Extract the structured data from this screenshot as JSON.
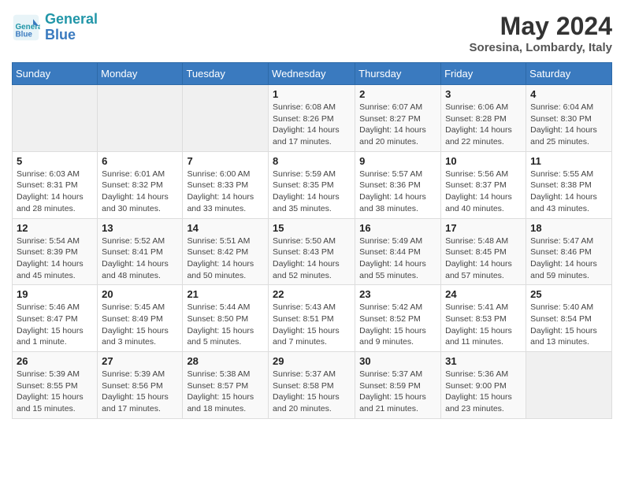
{
  "header": {
    "logo_line1": "General",
    "logo_line2": "Blue",
    "month_year": "May 2024",
    "location": "Soresina, Lombardy, Italy"
  },
  "days_of_week": [
    "Sunday",
    "Monday",
    "Tuesday",
    "Wednesday",
    "Thursday",
    "Friday",
    "Saturday"
  ],
  "weeks": [
    [
      {
        "day": "",
        "info": ""
      },
      {
        "day": "",
        "info": ""
      },
      {
        "day": "",
        "info": ""
      },
      {
        "day": "1",
        "info": "Sunrise: 6:08 AM\nSunset: 8:26 PM\nDaylight: 14 hours\nand 17 minutes."
      },
      {
        "day": "2",
        "info": "Sunrise: 6:07 AM\nSunset: 8:27 PM\nDaylight: 14 hours\nand 20 minutes."
      },
      {
        "day": "3",
        "info": "Sunrise: 6:06 AM\nSunset: 8:28 PM\nDaylight: 14 hours\nand 22 minutes."
      },
      {
        "day": "4",
        "info": "Sunrise: 6:04 AM\nSunset: 8:30 PM\nDaylight: 14 hours\nand 25 minutes."
      }
    ],
    [
      {
        "day": "5",
        "info": "Sunrise: 6:03 AM\nSunset: 8:31 PM\nDaylight: 14 hours\nand 28 minutes."
      },
      {
        "day": "6",
        "info": "Sunrise: 6:01 AM\nSunset: 8:32 PM\nDaylight: 14 hours\nand 30 minutes."
      },
      {
        "day": "7",
        "info": "Sunrise: 6:00 AM\nSunset: 8:33 PM\nDaylight: 14 hours\nand 33 minutes."
      },
      {
        "day": "8",
        "info": "Sunrise: 5:59 AM\nSunset: 8:35 PM\nDaylight: 14 hours\nand 35 minutes."
      },
      {
        "day": "9",
        "info": "Sunrise: 5:57 AM\nSunset: 8:36 PM\nDaylight: 14 hours\nand 38 minutes."
      },
      {
        "day": "10",
        "info": "Sunrise: 5:56 AM\nSunset: 8:37 PM\nDaylight: 14 hours\nand 40 minutes."
      },
      {
        "day": "11",
        "info": "Sunrise: 5:55 AM\nSunset: 8:38 PM\nDaylight: 14 hours\nand 43 minutes."
      }
    ],
    [
      {
        "day": "12",
        "info": "Sunrise: 5:54 AM\nSunset: 8:39 PM\nDaylight: 14 hours\nand 45 minutes."
      },
      {
        "day": "13",
        "info": "Sunrise: 5:52 AM\nSunset: 8:41 PM\nDaylight: 14 hours\nand 48 minutes."
      },
      {
        "day": "14",
        "info": "Sunrise: 5:51 AM\nSunset: 8:42 PM\nDaylight: 14 hours\nand 50 minutes."
      },
      {
        "day": "15",
        "info": "Sunrise: 5:50 AM\nSunset: 8:43 PM\nDaylight: 14 hours\nand 52 minutes."
      },
      {
        "day": "16",
        "info": "Sunrise: 5:49 AM\nSunset: 8:44 PM\nDaylight: 14 hours\nand 55 minutes."
      },
      {
        "day": "17",
        "info": "Sunrise: 5:48 AM\nSunset: 8:45 PM\nDaylight: 14 hours\nand 57 minutes."
      },
      {
        "day": "18",
        "info": "Sunrise: 5:47 AM\nSunset: 8:46 PM\nDaylight: 14 hours\nand 59 minutes."
      }
    ],
    [
      {
        "day": "19",
        "info": "Sunrise: 5:46 AM\nSunset: 8:47 PM\nDaylight: 15 hours\nand 1 minute."
      },
      {
        "day": "20",
        "info": "Sunrise: 5:45 AM\nSunset: 8:49 PM\nDaylight: 15 hours\nand 3 minutes."
      },
      {
        "day": "21",
        "info": "Sunrise: 5:44 AM\nSunset: 8:50 PM\nDaylight: 15 hours\nand 5 minutes."
      },
      {
        "day": "22",
        "info": "Sunrise: 5:43 AM\nSunset: 8:51 PM\nDaylight: 15 hours\nand 7 minutes."
      },
      {
        "day": "23",
        "info": "Sunrise: 5:42 AM\nSunset: 8:52 PM\nDaylight: 15 hours\nand 9 minutes."
      },
      {
        "day": "24",
        "info": "Sunrise: 5:41 AM\nSunset: 8:53 PM\nDaylight: 15 hours\nand 11 minutes."
      },
      {
        "day": "25",
        "info": "Sunrise: 5:40 AM\nSunset: 8:54 PM\nDaylight: 15 hours\nand 13 minutes."
      }
    ],
    [
      {
        "day": "26",
        "info": "Sunrise: 5:39 AM\nSunset: 8:55 PM\nDaylight: 15 hours\nand 15 minutes."
      },
      {
        "day": "27",
        "info": "Sunrise: 5:39 AM\nSunset: 8:56 PM\nDaylight: 15 hours\nand 17 minutes."
      },
      {
        "day": "28",
        "info": "Sunrise: 5:38 AM\nSunset: 8:57 PM\nDaylight: 15 hours\nand 18 minutes."
      },
      {
        "day": "29",
        "info": "Sunrise: 5:37 AM\nSunset: 8:58 PM\nDaylight: 15 hours\nand 20 minutes."
      },
      {
        "day": "30",
        "info": "Sunrise: 5:37 AM\nSunset: 8:59 PM\nDaylight: 15 hours\nand 21 minutes."
      },
      {
        "day": "31",
        "info": "Sunrise: 5:36 AM\nSunset: 9:00 PM\nDaylight: 15 hours\nand 23 minutes."
      },
      {
        "day": "",
        "info": ""
      }
    ]
  ]
}
